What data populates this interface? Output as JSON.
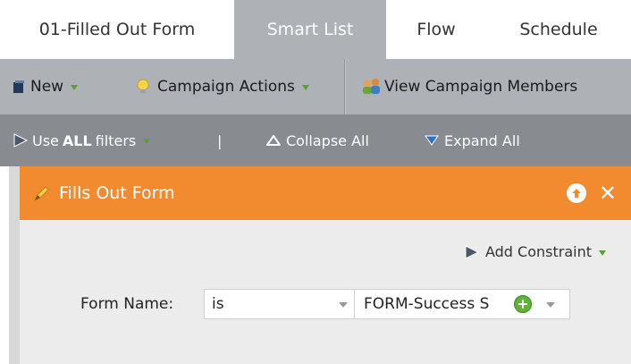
{
  "tabs": [
    {
      "label": "01-Filled Out Form",
      "active": false
    },
    {
      "label": "Smart List",
      "active": true
    },
    {
      "label": "Flow",
      "active": false
    },
    {
      "label": "Schedule",
      "active": false
    }
  ],
  "toolbar": {
    "new_label": "New",
    "campaign_actions_label": "Campaign Actions",
    "view_members_label": "View Campaign Members"
  },
  "filterbar": {
    "use_prefix": "Use",
    "use_bold": "ALL",
    "use_suffix": "filters",
    "separator": "|",
    "collapse_label": "Collapse All",
    "expand_label": "Expand All"
  },
  "filter_card": {
    "title": "Fills Out Form",
    "add_constraint_label": "Add Constraint",
    "row": {
      "label": "Form Name:",
      "operator": "is",
      "value": "FORM-Success S"
    }
  },
  "colors": {
    "header_orange": "#f28a30",
    "active_tab": "#aeb2b6",
    "filter_bar": "#888c91",
    "accent_green": "#5aa02c"
  }
}
